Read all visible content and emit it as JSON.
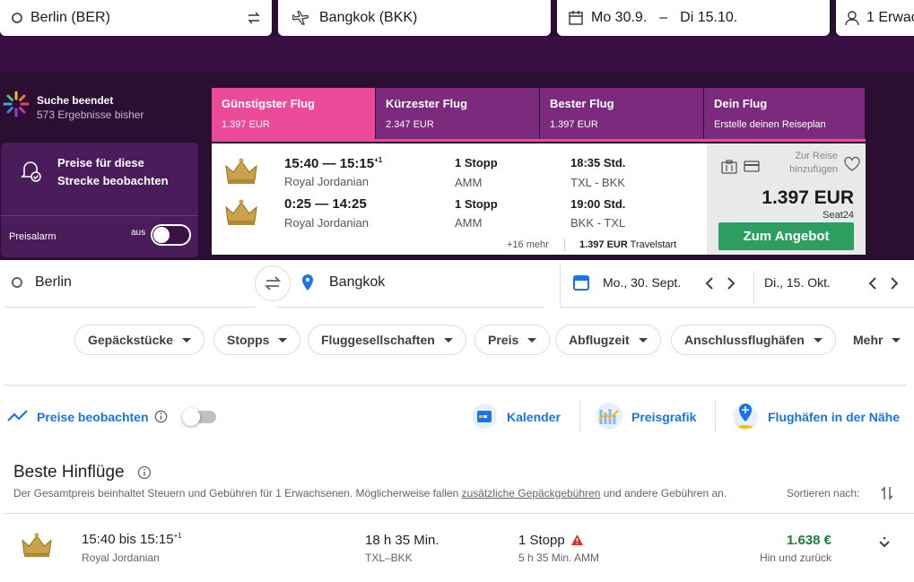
{
  "kayak": {
    "origin": "Berlin (BER)",
    "destination": "Bangkok (BKK)",
    "date_from": "Mo 30.9.",
    "date_sep": "–",
    "date_to": "Di 15.10.",
    "travelers": "1 Erwac",
    "status_title": "Suche beendet",
    "status_sub": "573 Ergebnisse bisher",
    "watch_text": "Preise für diese Strecke beobachten",
    "alarm_label": "Preisalarm",
    "alarm_state": "aus",
    "tabs": [
      {
        "label": "Günstigster Flug",
        "value": "1.397 EUR",
        "color": "#ea4a98"
      },
      {
        "label": "Kürzester Flug",
        "value": "2.347 EUR",
        "color": "#7c2a7e"
      },
      {
        "label": "Bester Flug",
        "value": "1.397 EUR",
        "color": "#7c2a7e"
      },
      {
        "label": "Dein Flug",
        "value": "Erstelle deinen Reiseplan",
        "color": "#7c2a7e"
      }
    ],
    "result": {
      "out_time": "15:40 — 15:15",
      "out_plus": "+1",
      "out_airline": "Royal Jordanian",
      "out_stops": "1 Stopp",
      "out_via": "AMM",
      "out_duration": "18:35 Std.",
      "out_route": "TXL - BKK",
      "ret_time": "0:25 — 14:25",
      "ret_airline": "Royal Jordanian",
      "ret_stops": "1 Stopp",
      "ret_via": "AMM",
      "ret_duration": "19:00 Std.",
      "ret_route": "BKK - TXL",
      "more": "+16 mehr",
      "alt_price": "1.397 EUR",
      "alt_provider": "Travelstart",
      "add_trip": "Zur Reise hinzufügen",
      "price": "1.397 EUR",
      "provider": "Seat24",
      "cta": "Zum Angebot"
    }
  },
  "gflights": {
    "origin": "Berlin",
    "destination": "Bangkok",
    "date_from": "Mo., 30. Sept.",
    "date_to": "Di., 15. Okt.",
    "filters": [
      "Gepäckstücke",
      "Stopps",
      "Fluggesellschaften",
      "Preis",
      "Abflugzeit",
      "Anschlussflughäfen"
    ],
    "more": "Mehr",
    "track_prices": "Preise beobachten",
    "calendar": "Kalender",
    "price_graph": "Preisgrafik",
    "nearby": "Flughäfen in der Nähe",
    "section_title": "Beste Hinflüge",
    "disclaimer_pre": "Der Gesamtpreis beinhaltet Steuern und Gebühren für 1 Erwachsenen. Möglicherweise fallen ",
    "disclaimer_link": "zusätzliche Gepäckgebühren",
    "disclaimer_post": " und andere Gebühren an.",
    "sort_label": "Sortieren nach:",
    "flight": {
      "times": "15:40 bis 15:15",
      "plus": "+1",
      "airline": "Royal Jordanian",
      "duration": "18 h 35 Min.",
      "route": "TXL–BKK",
      "stops": "1 Stopp",
      "layover": "5 h 35 Min. AMM",
      "price": "1.638 €",
      "price_type": "Hin und zurück"
    }
  }
}
